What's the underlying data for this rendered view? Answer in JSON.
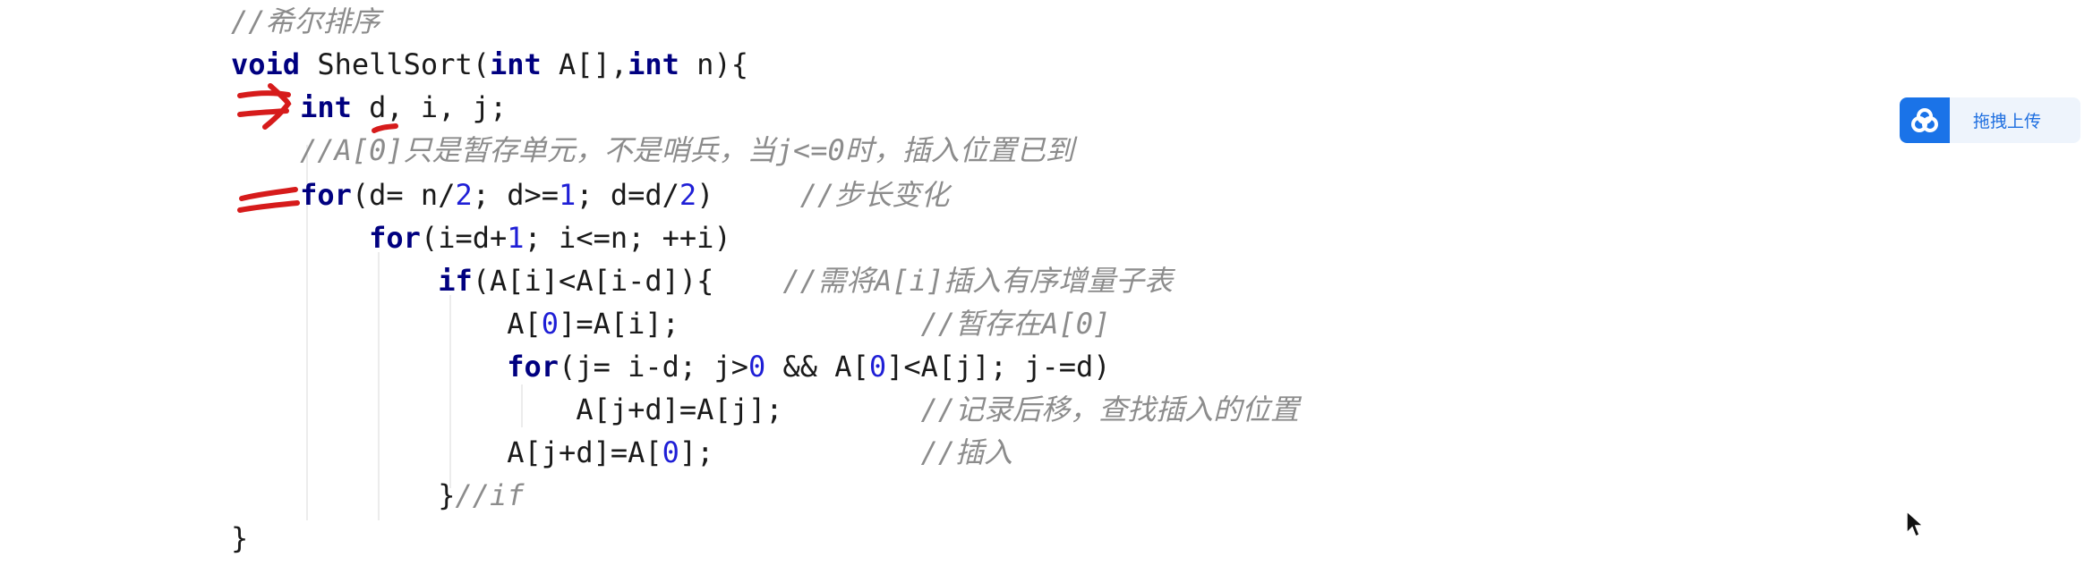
{
  "code": {
    "lines": [
      [
        {
          "t": "//希尔排序",
          "c": "cm"
        }
      ],
      [
        {
          "t": "void",
          "c": "kw"
        },
        {
          "t": " ShellSort(",
          "c": "plain"
        },
        {
          "t": "int",
          "c": "kw"
        },
        {
          "t": " A[],",
          "c": "plain"
        },
        {
          "t": "int",
          "c": "kw"
        },
        {
          "t": " n){",
          "c": "plain"
        }
      ],
      [
        {
          "t": "    ",
          "c": "plain"
        },
        {
          "t": "int",
          "c": "kw"
        },
        {
          "t": " d, i, j;",
          "c": "plain"
        }
      ],
      [
        {
          "t": "    //A[0]只是暂存单元，不是哨兵，当j<=0时，插入位置已到",
          "c": "cm"
        }
      ],
      [
        {
          "t": "    ",
          "c": "plain"
        },
        {
          "t": "for",
          "c": "kw"
        },
        {
          "t": "(d= n/",
          "c": "plain"
        },
        {
          "t": "2",
          "c": "num"
        },
        {
          "t": "; d>=",
          "c": "plain"
        },
        {
          "t": "1",
          "c": "num"
        },
        {
          "t": "; d=d/",
          "c": "plain"
        },
        {
          "t": "2",
          "c": "num"
        },
        {
          "t": ")     ",
          "c": "plain"
        },
        {
          "t": "//步长变化",
          "c": "cm"
        }
      ],
      [
        {
          "t": "        ",
          "c": "plain"
        },
        {
          "t": "for",
          "c": "kw"
        },
        {
          "t": "(i=d+",
          "c": "plain"
        },
        {
          "t": "1",
          "c": "num"
        },
        {
          "t": "; i<=n; ++i)",
          "c": "plain"
        }
      ],
      [
        {
          "t": "            ",
          "c": "plain"
        },
        {
          "t": "if",
          "c": "kw"
        },
        {
          "t": "(A[i]<A[i-d]){    ",
          "c": "plain"
        },
        {
          "t": "//需将A[i]插入有序增量子表",
          "c": "cm"
        }
      ],
      [
        {
          "t": "                A[",
          "c": "plain"
        },
        {
          "t": "0",
          "c": "num"
        },
        {
          "t": "]=A[i];              ",
          "c": "plain"
        },
        {
          "t": "//暂存在A[0]",
          "c": "cm"
        }
      ],
      [
        {
          "t": "                ",
          "c": "plain"
        },
        {
          "t": "for",
          "c": "kw"
        },
        {
          "t": "(j= i-d; j>",
          "c": "plain"
        },
        {
          "t": "0",
          "c": "num"
        },
        {
          "t": " && A[",
          "c": "plain"
        },
        {
          "t": "0",
          "c": "num"
        },
        {
          "t": "]<A[j]; j-=d)",
          "c": "plain"
        }
      ],
      [
        {
          "t": "                    A[j+d]=A[j];        ",
          "c": "plain"
        },
        {
          "t": "//记录后移，查找插入的位置",
          "c": "cm"
        }
      ],
      [
        {
          "t": "                A[j+d]=A[",
          "c": "plain"
        },
        {
          "t": "0",
          "c": "num"
        },
        {
          "t": "];            ",
          "c": "plain"
        },
        {
          "t": "//插入",
          "c": "cm"
        }
      ],
      [
        {
          "t": "            }",
          "c": "plain"
        },
        {
          "t": "//if",
          "c": "cm"
        }
      ],
      [
        {
          "t": "}",
          "c": "plain"
        }
      ]
    ]
  },
  "upload": {
    "label": "拖拽上传",
    "icon": "cloud-upload-icon",
    "color": "#1a73e8"
  },
  "annotations": {
    "color": "#d61b1b",
    "marks": [
      "double-arrow-mark",
      "underline-mark",
      "double-dash-mark"
    ]
  },
  "cursor": {
    "icon": "mouse-pointer-icon"
  }
}
